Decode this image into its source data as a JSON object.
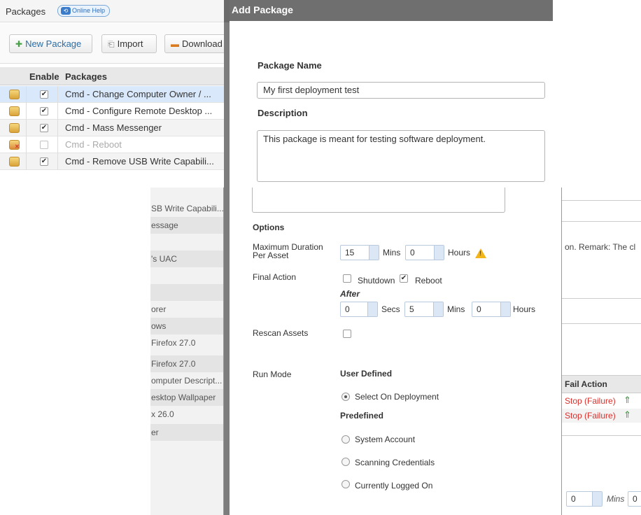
{
  "packages_panel": {
    "title": "Packages",
    "online_help": "Online Help",
    "toolbar": {
      "new_package": "New Package",
      "import": "Import",
      "download": "Download"
    },
    "columns": {
      "enable": "Enable",
      "packages": "Packages"
    },
    "rows": [
      {
        "name": "Cmd - Change Computer Owner / ...",
        "enabled": "✔"
      },
      {
        "name": "Cmd - Configure Remote Desktop ...",
        "enabled": "✔"
      },
      {
        "name": "Cmd - Mass Messenger",
        "enabled": "✔"
      },
      {
        "name": "Cmd - Reboot",
        "enabled": ""
      },
      {
        "name": "Cmd - Remove USB Write Capabili...",
        "enabled": "✔"
      }
    ]
  },
  "background_list": [
    "SB Write Capabili...",
    "essage",
    "",
    "'s UAC",
    "",
    "",
    "orer",
    "ows",
    "Firefox 27.0",
    "Firefox 27.0",
    "omputer Descript...",
    "esktop Wallpaper",
    "x 26.0",
    "er"
  ],
  "dialog": {
    "title": "Add Package",
    "package_name_label": "Package Name",
    "package_name_value": "My first deployment test",
    "description_label": "Description",
    "description_value": "This package is meant for testing software deployment.",
    "options_label": "Options",
    "max_duration_label": "Maximum Duration Per Asset",
    "max_duration_mins": "15",
    "mins_label": "Mins",
    "max_duration_hours": "0",
    "hours_label": "Hours",
    "warning_icon": "warning-icon",
    "final_action_label": "Final Action",
    "shutdown_label": "Shutdown",
    "shutdown_checked": "",
    "reboot_label": "Reboot",
    "reboot_checked": "✔",
    "after_label": "After",
    "after_secs": "0",
    "secs_label": "Secs",
    "after_mins": "5",
    "after_mins_label": "Mins",
    "after_hours": "0",
    "after_hours_label": "Hours",
    "rescan_label": "Rescan Assets",
    "run_mode_label": "Run Mode",
    "user_defined_label": "User Defined",
    "select_on_deployment": "Select On Deployment",
    "predefined_label": "Predefined",
    "system_account": "System Account",
    "scanning_credentials": "Scanning Credentials",
    "currently_logged_on": "Currently Logged On"
  },
  "background_right": {
    "remark_text": "on. Remark: The cl",
    "fail_action_header": "Fail Action",
    "fail_rows": [
      "Stop (Failure)",
      "Stop (Failure)"
    ],
    "bottom_value": "0",
    "bottom_mins": "Mins",
    "bottom_value2": "0"
  },
  "colors": {
    "failure_red": "#d9302c",
    "arrow_green": "#3c9a3c",
    "title_bar": "#6f6f6f"
  }
}
